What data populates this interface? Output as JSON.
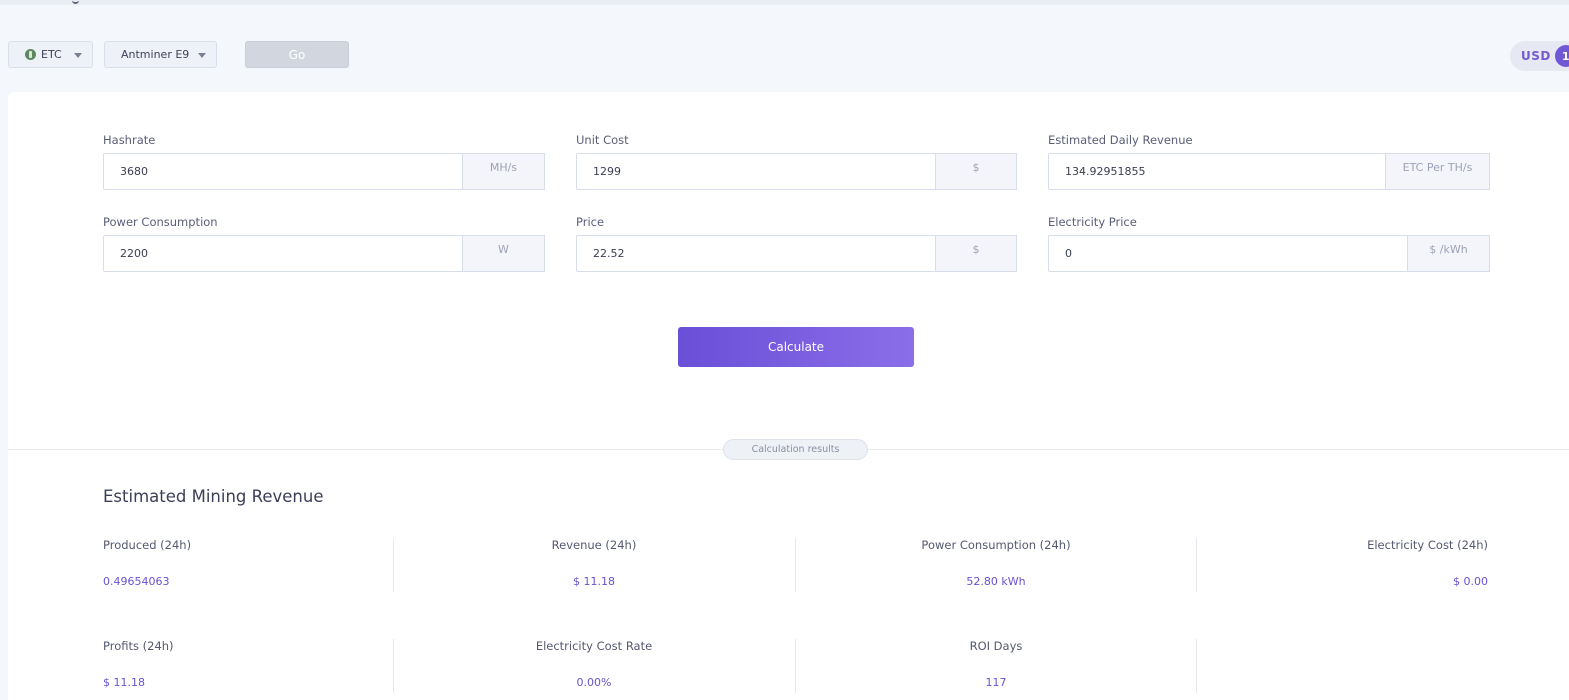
{
  "toolbar": {
    "coin": "ETC",
    "miner": "Antminer E9",
    "go_label": "Go",
    "currency": "USD",
    "currency_knob": "1"
  },
  "form": {
    "hashrate": {
      "label": "Hashrate",
      "value": "3680",
      "unit": "MH/s"
    },
    "unit_cost": {
      "label": "Unit Cost",
      "value": "1299",
      "unit": "$"
    },
    "daily_revenue": {
      "label": "Estimated Daily Revenue",
      "value": "134.92951855",
      "unit": "ETC Per TH/s"
    },
    "power": {
      "label": "Power Consumption",
      "value": "2200",
      "unit": "W"
    },
    "price": {
      "label": "Price",
      "value": "22.52",
      "unit": "$"
    },
    "electricity_price": {
      "label": "Electricity Price",
      "value": "0",
      "unit": "$ /kWh"
    },
    "calculate_label": "Calculate"
  },
  "results": {
    "pill": "Calculation results",
    "title": "Estimated Mining Revenue",
    "stats": [
      {
        "label": "Produced (24h)",
        "value": "0.49654063"
      },
      {
        "label": "Revenue (24h)",
        "value": "$ 11.18"
      },
      {
        "label": "Power Consumption (24h)",
        "value": "52.80 kWh"
      },
      {
        "label": "Electricity Cost (24h)",
        "value": "$ 0.00"
      },
      {
        "label": "Profits (24h)",
        "value": "$ 11.18"
      },
      {
        "label": "Electricity Cost Rate",
        "value": "0.00%"
      },
      {
        "label": "ROI Days",
        "value": "117"
      }
    ]
  },
  "colors": {
    "accent": "#6a4fd8",
    "value_text": "#6a52cf",
    "background": "#f4f7fb"
  },
  "icons": {
    "coin": "etc-coin-icon",
    "dropdown": "chevron-down-icon"
  }
}
